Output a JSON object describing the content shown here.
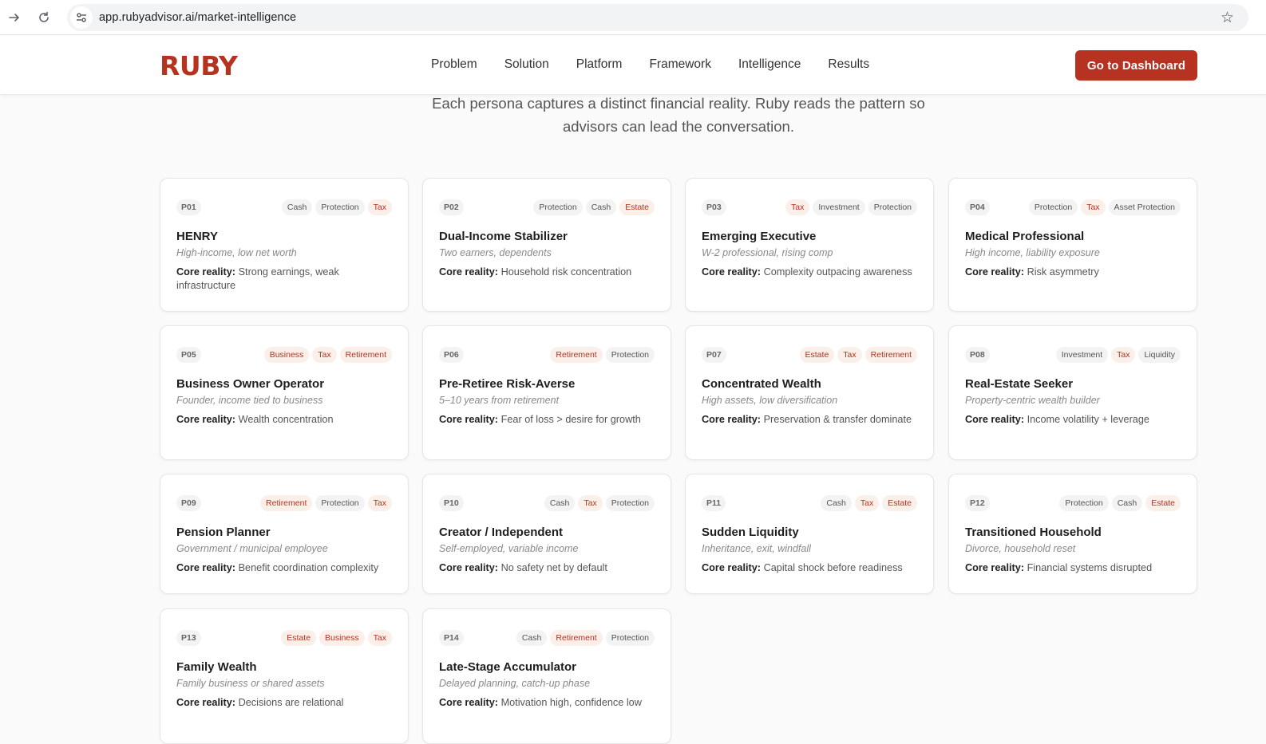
{
  "browser": {
    "url": "app.rubyadvisor.ai/market-intelligence"
  },
  "header": {
    "logo": "RUBY",
    "nav": [
      "Problem",
      "Solution",
      "Platform",
      "Framework",
      "Intelligence",
      "Results"
    ],
    "cta": "Go to Dashboard"
  },
  "intro": {
    "line1": "Each persona captures a distinct financial reality. Ruby reads the pattern so",
    "line2": "advisors can lead the conversation."
  },
  "core_label": "Core reality:",
  "cards": [
    {
      "id": "P01",
      "tags": [
        {
          "t": "Cash",
          "c": "gray"
        },
        {
          "t": "Protection",
          "c": "gray"
        },
        {
          "t": "Tax",
          "c": "red"
        }
      ],
      "title": "HENRY",
      "sub": "High-income, low net worth",
      "core": "Strong earnings, weak infrastructure"
    },
    {
      "id": "P02",
      "tags": [
        {
          "t": "Protection",
          "c": "gray"
        },
        {
          "t": "Cash",
          "c": "gray"
        },
        {
          "t": "Estate",
          "c": "red"
        }
      ],
      "title": "Dual-Income Stabilizer",
      "sub": "Two earners, dependents",
      "core": "Household risk concentration"
    },
    {
      "id": "P03",
      "tags": [
        {
          "t": "Tax",
          "c": "red"
        },
        {
          "t": "Investment",
          "c": "gray"
        },
        {
          "t": "Protection",
          "c": "gray"
        }
      ],
      "title": "Emerging Executive",
      "sub": "W-2 professional, rising comp",
      "core": "Complexity outpacing awareness"
    },
    {
      "id": "P04",
      "tags": [
        {
          "t": "Protection",
          "c": "gray"
        },
        {
          "t": "Tax",
          "c": "red"
        },
        {
          "t": "Asset Protection",
          "c": "gray"
        }
      ],
      "title": "Medical Professional",
      "sub": "High income, liability exposure",
      "core": "Risk asymmetry"
    },
    {
      "id": "P05",
      "tags": [
        {
          "t": "Business",
          "c": "red"
        },
        {
          "t": "Tax",
          "c": "red"
        },
        {
          "t": "Retirement",
          "c": "red"
        }
      ],
      "title": "Business Owner Operator",
      "sub": "Founder, income tied to business",
      "core": "Wealth concentration"
    },
    {
      "id": "P06",
      "tags": [
        {
          "t": "Retirement",
          "c": "red"
        },
        {
          "t": "Protection",
          "c": "gray"
        }
      ],
      "title": "Pre-Retiree Risk-Averse",
      "sub": "5–10 years from retirement",
      "core": "Fear of loss > desire for growth"
    },
    {
      "id": "P07",
      "tags": [
        {
          "t": "Estate",
          "c": "red"
        },
        {
          "t": "Tax",
          "c": "red"
        },
        {
          "t": "Retirement",
          "c": "red"
        }
      ],
      "title": "Concentrated Wealth",
      "sub": "High assets, low diversification",
      "core": "Preservation & transfer dominate"
    },
    {
      "id": "P08",
      "tags": [
        {
          "t": "Investment",
          "c": "gray"
        },
        {
          "t": "Tax",
          "c": "red"
        },
        {
          "t": "Liquidity",
          "c": "gray"
        }
      ],
      "title": "Real-Estate Seeker",
      "sub": "Property-centric wealth builder",
      "core": "Income volatility + leverage"
    },
    {
      "id": "P09",
      "tags": [
        {
          "t": "Retirement",
          "c": "red"
        },
        {
          "t": "Protection",
          "c": "gray"
        },
        {
          "t": "Tax",
          "c": "red"
        }
      ],
      "title": "Pension Planner",
      "sub": "Government / municipal employee",
      "core": "Benefit coordination complexity"
    },
    {
      "id": "P10",
      "tags": [
        {
          "t": "Cash",
          "c": "gray"
        },
        {
          "t": "Tax",
          "c": "red"
        },
        {
          "t": "Protection",
          "c": "gray"
        }
      ],
      "title": "Creator / Independent",
      "sub": "Self-employed, variable income",
      "core": "No safety net by default"
    },
    {
      "id": "P11",
      "tags": [
        {
          "t": "Cash",
          "c": "gray"
        },
        {
          "t": "Tax",
          "c": "red"
        },
        {
          "t": "Estate",
          "c": "red"
        }
      ],
      "title": "Sudden Liquidity",
      "sub": "Inheritance, exit, windfall",
      "core": "Capital shock before readiness"
    },
    {
      "id": "P12",
      "tags": [
        {
          "t": "Protection",
          "c": "gray"
        },
        {
          "t": "Cash",
          "c": "gray"
        },
        {
          "t": "Estate",
          "c": "red"
        }
      ],
      "title": "Transitioned Household",
      "sub": "Divorce, household reset",
      "core": "Financial systems disrupted"
    },
    {
      "id": "P13",
      "tags": [
        {
          "t": "Estate",
          "c": "red"
        },
        {
          "t": "Business",
          "c": "red"
        },
        {
          "t": "Tax",
          "c": "red"
        }
      ],
      "title": "Family Wealth",
      "sub": "Family business or shared assets",
      "core": "Decisions are relational"
    },
    {
      "id": "P14",
      "tags": [
        {
          "t": "Cash",
          "c": "gray"
        },
        {
          "t": "Retirement",
          "c": "red"
        },
        {
          "t": "Protection",
          "c": "gray"
        }
      ],
      "title": "Late-Stage Accumulator",
      "sub": "Delayed planning, catch-up phase",
      "core": "Motivation high, confidence low"
    }
  ]
}
